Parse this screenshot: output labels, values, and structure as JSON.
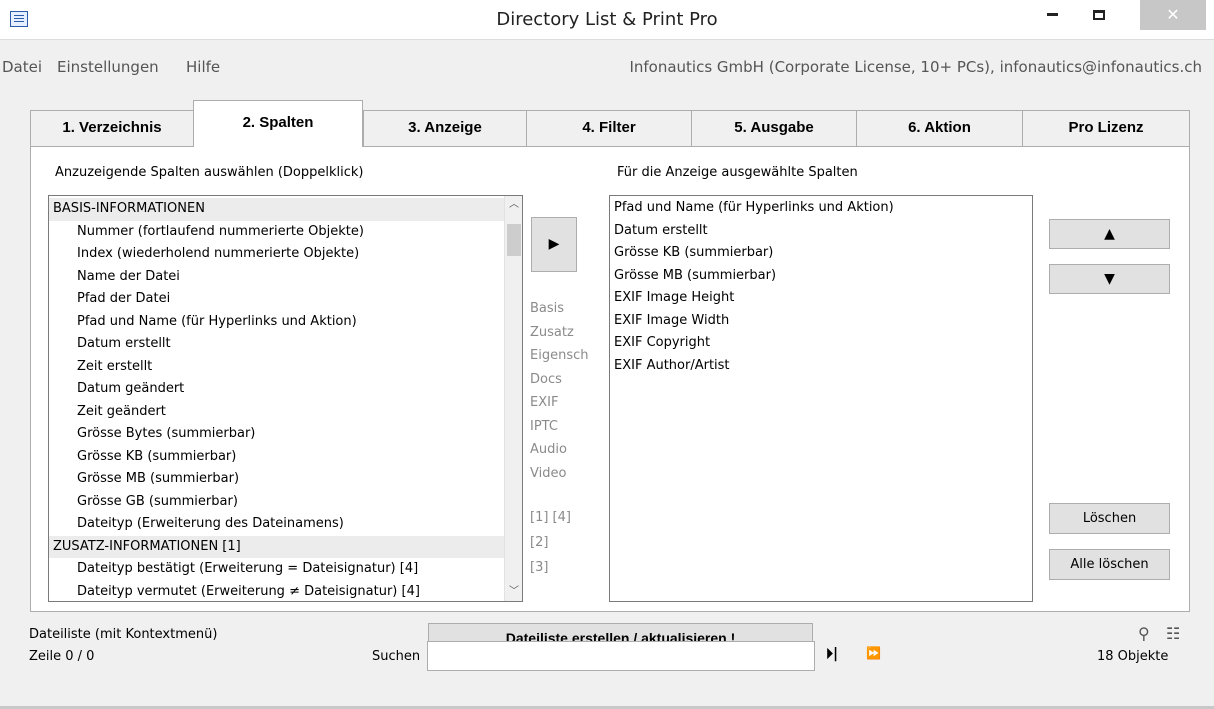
{
  "window": {
    "title": "Directory List & Print Pro",
    "close_glyph": "✕",
    "icon": "app-list-icon"
  },
  "menu": {
    "items": [
      "Datei",
      "Einstellungen",
      "Hilfe"
    ],
    "company": "Infonautics GmbH (Corporate License, 10+ PCs), infonautics@infonautics.ch"
  },
  "tabs": [
    "1. Verzeichnis",
    "2. Spalten",
    "3. Anzeige",
    "4. Filter",
    "5. Ausgabe",
    "6. Aktion",
    "Pro Lizenz"
  ],
  "active_tab": "2. Spalten",
  "left": {
    "label": "Anzuzeigende Spalten auswählen (Doppelklick)",
    "rows": [
      {
        "text": "BASIS-INFORMATIONEN",
        "section": true
      },
      {
        "text": "Nummer  (fortlaufend nummerierte Objekte)",
        "section": false
      },
      {
        "text": "Index  (wiederholend nummerierte Objekte)",
        "section": false
      },
      {
        "text": "Name der Datei",
        "section": false
      },
      {
        "text": "Pfad der Datei",
        "section": false
      },
      {
        "text": "Pfad und Name  (für Hyperlinks und Aktion)",
        "section": false
      },
      {
        "text": "Datum erstellt",
        "section": false
      },
      {
        "text": "Zeit erstellt",
        "section": false
      },
      {
        "text": "Datum geändert",
        "section": false
      },
      {
        "text": "Zeit geändert",
        "section": false
      },
      {
        "text": "Grösse Bytes  (summierbar)",
        "section": false
      },
      {
        "text": "Grösse KB  (summierbar)",
        "section": false
      },
      {
        "text": "Grösse MB  (summierbar)",
        "section": false
      },
      {
        "text": "Grösse GB  (summierbar)",
        "section": false
      },
      {
        "text": "Dateityp  (Erweiterung des Dateinamens)",
        "section": false
      },
      {
        "text": "ZUSATZ-INFORMATIONEN [1]",
        "section": true
      },
      {
        "text": "Dateityp bestätigt  (Erweiterung = Dateisignatur) [4]",
        "section": false
      },
      {
        "text": "Dateityp vermutet  (Erweiterung ≠ Dateisignatur) [4]",
        "section": false
      }
    ]
  },
  "middle": {
    "add_arrow": "▶",
    "categories": [
      "Basis",
      "Zusatz",
      "Eigensch",
      "Docs",
      "EXIF",
      "IPTC",
      "Audio",
      "Video"
    ],
    "notes": [
      "[1]  [4]",
      "[2]",
      "[3]"
    ]
  },
  "right": {
    "label": "Für die Anzeige ausgewählte Spalten",
    "rows": [
      "Pfad und Name  (für Hyperlinks und Aktion)",
      "Datum erstellt",
      "Grösse KB  (summierbar)",
      "Grösse MB  (summierbar)",
      "EXIF Image Height",
      "EXIF Image Width",
      "EXIF Copyright",
      "EXIF Author/Artist"
    ]
  },
  "buttons": {
    "up": "▲",
    "down": "▼",
    "delete": "Löschen",
    "delete_all": "Alle löschen",
    "create": "Dateiliste erstellen / aktualisieren !"
  },
  "bottom": {
    "file_list_label": "Dateiliste (mit Kontextmenü)",
    "line_label": "Zeile 0 / 0",
    "search_label": "Suchen",
    "search_value": "",
    "step_glyph": "⏵|",
    "ff_glyph": "⏩",
    "count": "18 Objekte",
    "filter_icon_glyph": "⚲",
    "tree_icon_glyph": "☷"
  }
}
